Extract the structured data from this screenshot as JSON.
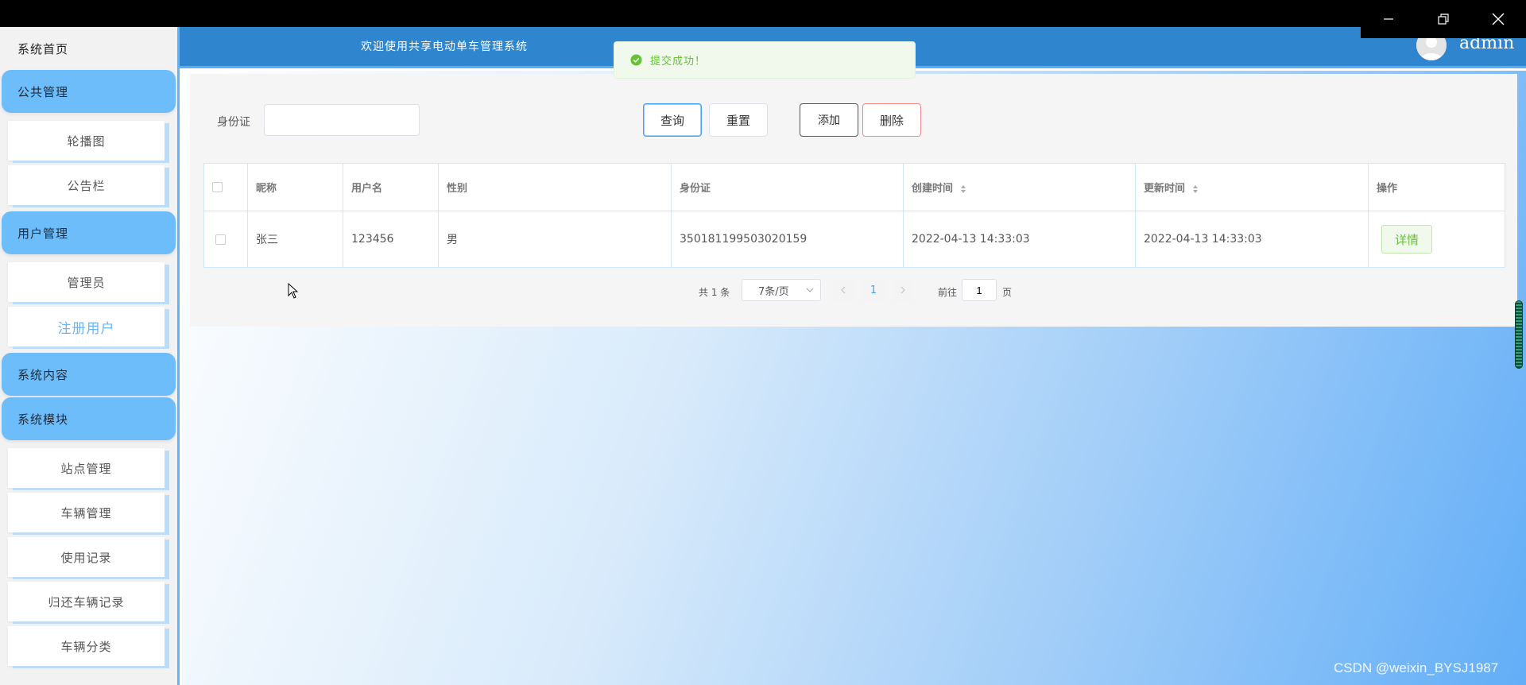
{
  "sidebar": {
    "home": "系统首页",
    "groups": [
      {
        "label": "公共管理",
        "items": [
          "轮播图",
          "公告栏"
        ]
      },
      {
        "label": "用户管理",
        "items": [
          "管理员",
          "注册用户"
        ]
      },
      {
        "label": "系统内容",
        "items": []
      },
      {
        "label": "系统模块",
        "items": [
          "站点管理",
          "车辆管理",
          "使用记录",
          "归还车辆记录",
          "车辆分类"
        ]
      }
    ],
    "active_item": "注册用户"
  },
  "header": {
    "welcome": "欢迎使用共享电动单车管理系统",
    "username": "admin"
  },
  "toast": {
    "message": "提交成功！"
  },
  "search": {
    "label": "身份证",
    "value": "",
    "query_label": "查询",
    "reset_label": "重置",
    "add_label": "添加",
    "delete_label": "删除"
  },
  "table": {
    "columns": [
      "昵称",
      "用户名",
      "性别",
      "身份证",
      "创建时间",
      "更新时间",
      "操作"
    ],
    "rows": [
      {
        "nickname": "张三",
        "username": "123456",
        "gender": "男",
        "id_card": "350181199503020159",
        "created": "2022-04-13 14:33:03",
        "updated": "2022-04-13 14:33:03",
        "action": "详情"
      }
    ]
  },
  "pagination": {
    "total_text": "共 1 条",
    "page_size": "7条/页",
    "current_page": "1",
    "goto_label": "前往",
    "goto_value": "1",
    "page_suffix": "页"
  },
  "watermark": "CSDN @weixin_BYSJ1987"
}
